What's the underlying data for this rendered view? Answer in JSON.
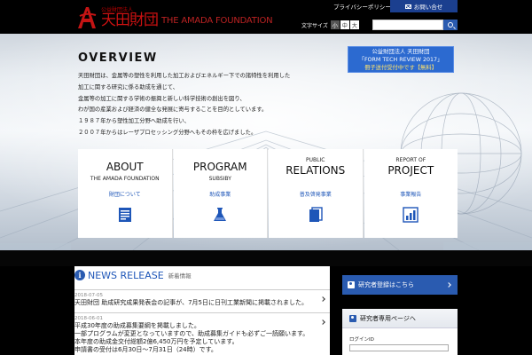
{
  "header": {
    "logo_small": "公益財団法人",
    "logo_kanji": "天田財団",
    "logo_en": "THE AMADA FOUNDATION",
    "privacy": "プライバシーポリシー",
    "contact": "お問い合せ",
    "fontsize_label": "文字サイズ",
    "fontsize_options": [
      "小",
      "中",
      "大"
    ],
    "search_placeholder": ""
  },
  "hero": {
    "title": "OVERVIEW",
    "lines": [
      "天田財団は、金属等の塑性を利用した加工およびエネルギー下での諸特性を利用した",
      "加工に関する研究に係る助成を通じて、",
      "金属等の加工に関する学術の振興と新しい科学技術の創出を図り、",
      "わが国の産業および経済の健全な発展に寄与することを目的としています。",
      "１９８７年から塑性加工分野へ助成を行い、",
      "２００７年からはレーザプロセッシング分野へもその枠を広げました。"
    ],
    "promo": {
      "line1": "公益財団法人 天田財団",
      "line2": "「FORM TECH REVIEW 2017」",
      "line3": "冊子送付受付中です【無料】"
    }
  },
  "cards": [
    {
      "small": "",
      "title": "ABOUT",
      "sub": "THE AMADA FOUNDATION",
      "jp": "財団について",
      "icon": "document-chart-icon"
    },
    {
      "small": "",
      "title": "PROGRAM",
      "sub": "SUBSIBY",
      "jp": "助成事業",
      "icon": "flask-icon"
    },
    {
      "small": "PUBLIC",
      "title": "RELATIONS",
      "sub": "",
      "jp": "普及啓発事業",
      "icon": "book-icon"
    },
    {
      "small": "REPORT OF",
      "title": "PROJECT",
      "sub": "",
      "jp": "事業報告",
      "icon": "bar-chart-icon"
    }
  ],
  "news": {
    "title": "NEWS RELEASE",
    "subtitle": "新着情報",
    "items": [
      {
        "date": "2018-07-05",
        "body": "天田財団 助成研究成果発表会の記事が、7月5日に日刊工業新聞に掲載されました。"
      },
      {
        "date": "2018-06-01",
        "lines": [
          "平成30年度の助成募集要綱を掲載しました。",
          "一部プログラムが変更となっていますので、助成募集ガイドも必ずご一読願います。",
          "本年度の助成金交付総額2億6,450万円を予定しています。",
          "申請書の受付は6月30日～7月31日（24時）です。"
        ]
      }
    ]
  },
  "sidebar": {
    "register": "研究者登録はこちら",
    "page_title": "研究者専用ページへ",
    "login_id": "ログインID"
  },
  "colors": {
    "accent": "#2a5bb0",
    "logo": "#c11111"
  }
}
